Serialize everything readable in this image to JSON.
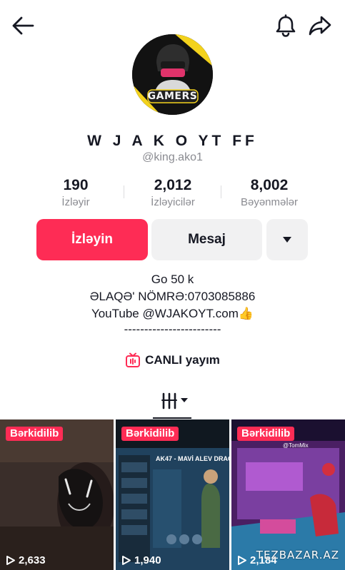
{
  "profile": {
    "display_name": "W J  A K O YT FF",
    "username": "@king.ako1",
    "avatar_text": "GAMERS"
  },
  "stats": [
    {
      "value": "190",
      "label": "İzləyir"
    },
    {
      "value": "2,012",
      "label": "İzləyicilər"
    },
    {
      "value": "8,002",
      "label": "Bəyənmələr"
    }
  ],
  "actions": {
    "follow_label": "İzləyin",
    "message_label": "Mesaj",
    "more_icon": "caret-down-icon"
  },
  "bio": {
    "line1": "Go 50 k",
    "line2": "ƏLAQƏ' NÖMRƏ:0703085886",
    "line3": "YouTube @WJAKOYT.com👍",
    "line4": "------------------------"
  },
  "live": {
    "label": "CANLI yayım",
    "icon": "live-tv-icon"
  },
  "tabs": {
    "active_icon": "grid-filter-icon"
  },
  "videos": [
    {
      "badge": "Bərkidilib",
      "views": "2,633",
      "caption": ""
    },
    {
      "badge": "Bərkidilib",
      "views": "1,940",
      "caption": "AK47 - MAVİ ALEV DRAG"
    },
    {
      "badge": "Bərkidilib",
      "views": "2,184",
      "caption": "@TomMix"
    }
  ],
  "watermark": "TEZBAZAR.AZ",
  "colors": {
    "accent": "#fe2c55",
    "secondary_button": "#f1f1f2",
    "text_primary": "#161823",
    "text_secondary": "#8a8b91"
  }
}
